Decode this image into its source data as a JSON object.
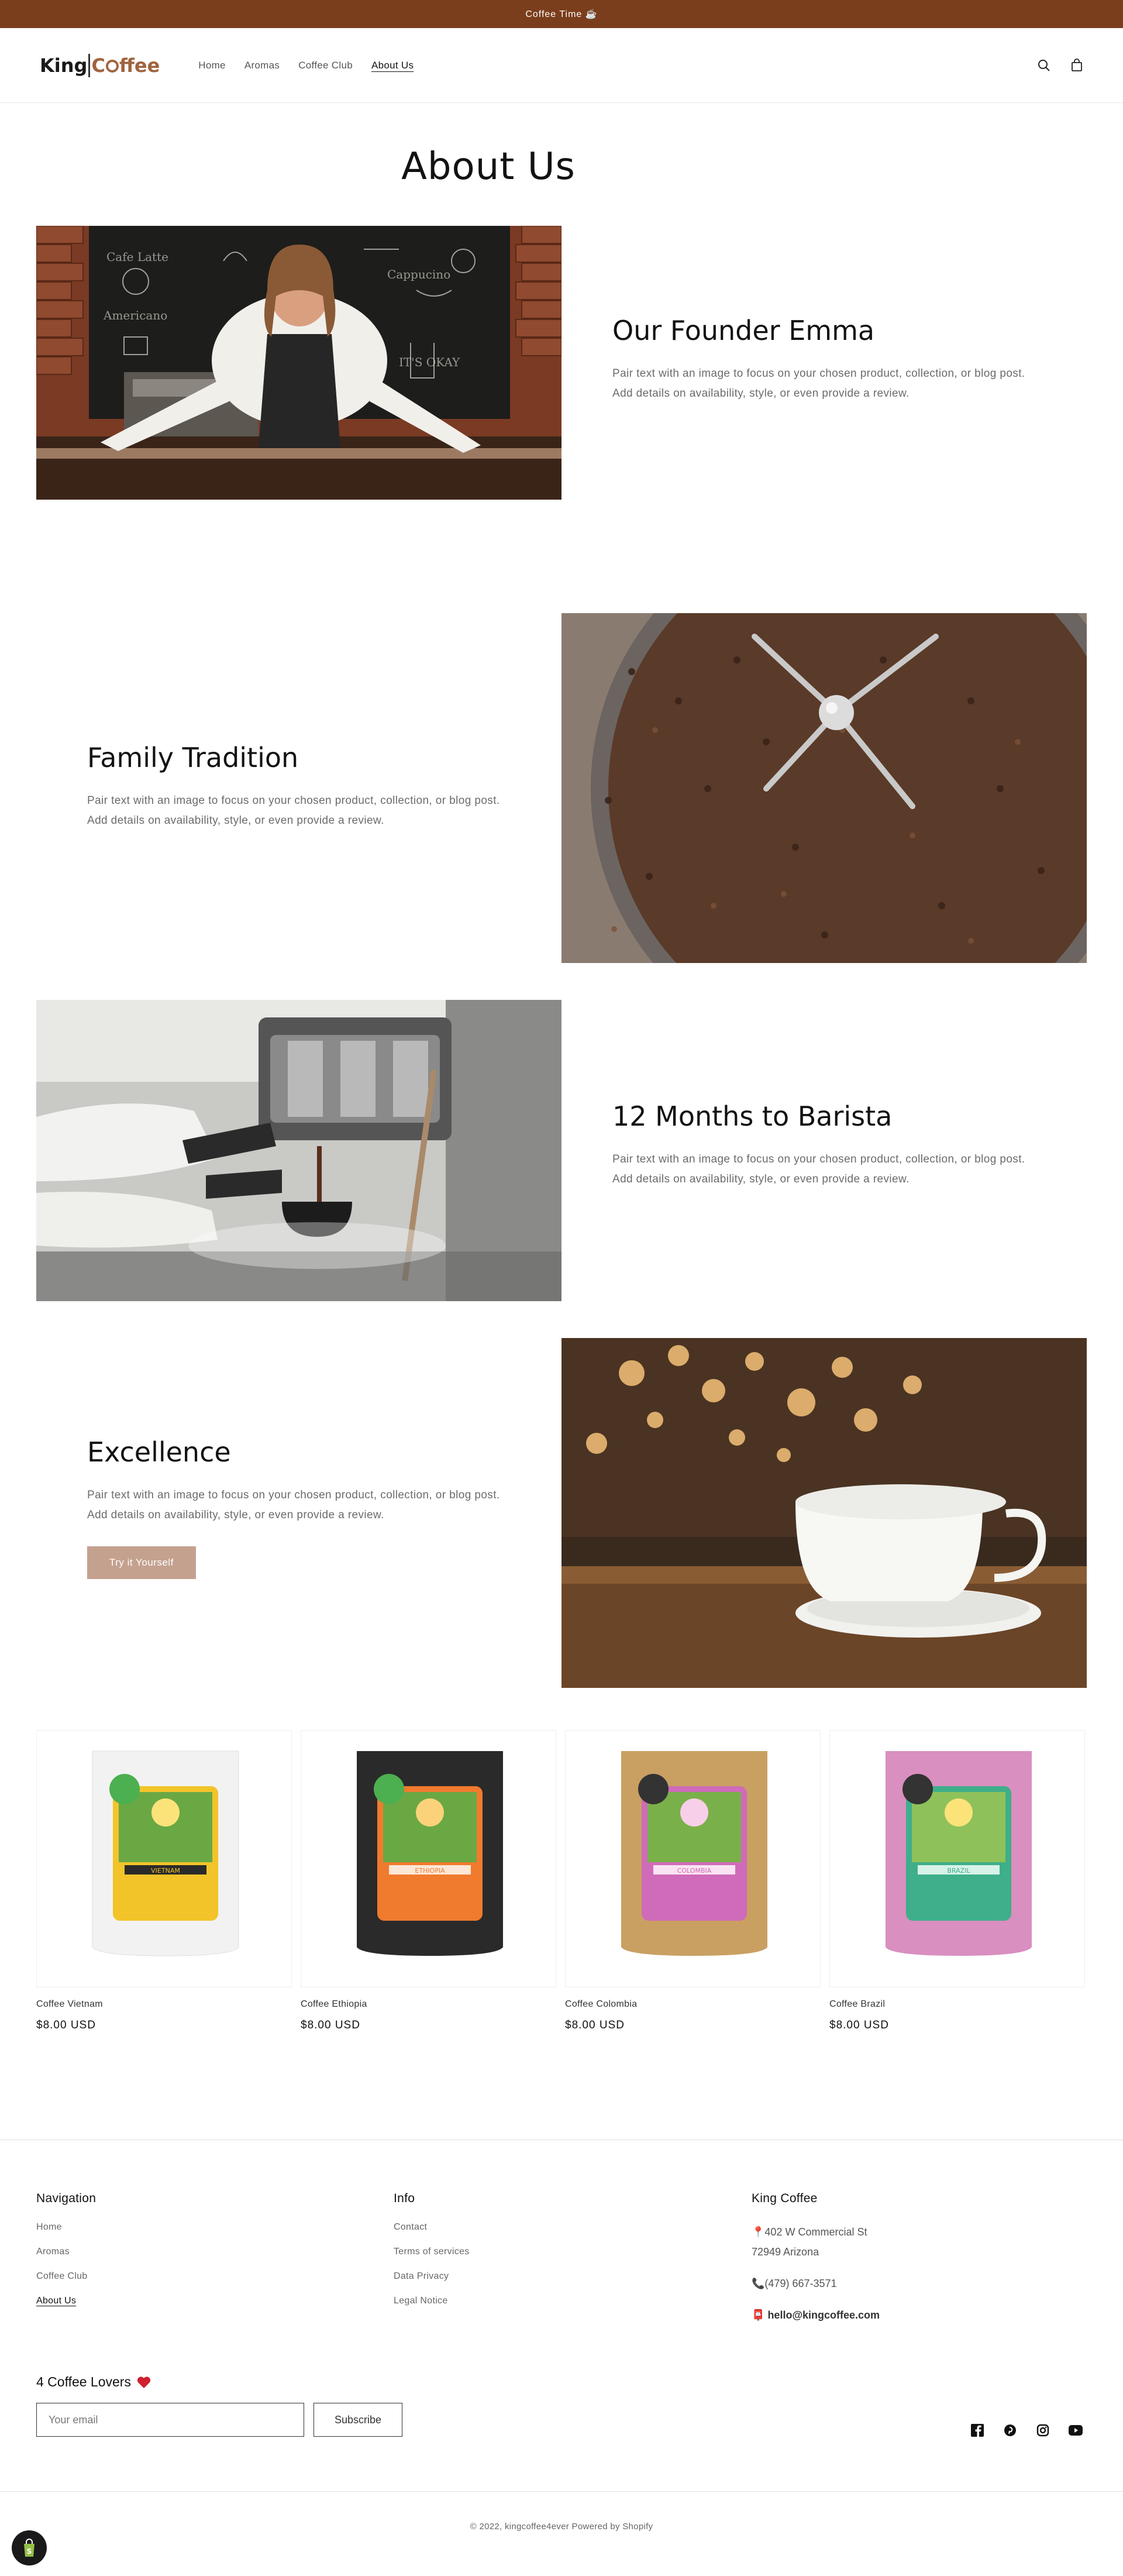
{
  "announcement": {
    "text": "Coffee Time ☕"
  },
  "header": {
    "logo_king": "King",
    "logo_c": "C",
    "logo_ffee": "ffee",
    "nav": [
      {
        "label": "Home"
      },
      {
        "label": "Aromas"
      },
      {
        "label": "Coffee Club"
      },
      {
        "label": "About Us"
      }
    ],
    "active_nav": "About Us",
    "icons": [
      "search-icon",
      "cart-icon"
    ]
  },
  "page": {
    "title": "About Us"
  },
  "sections": [
    {
      "heading": "Our Founder Emma",
      "body": "Pair text with an image to focus on your chosen product, collection, or blog post. Add details on availability, style, or even provide a review.",
      "image": "barista-woman-photo"
    },
    {
      "heading": "Family Tradition",
      "body": "Pair text with an image to focus on your chosen product, collection, or blog post. Add details on availability, style, or even provide a review.",
      "image": "coffee-roaster-photo"
    },
    {
      "heading": "12 Months to Barista",
      "body": "Pair text with an image to focus on your chosen product, collection, or blog post. Add details on availability, style, or even provide a review.",
      "image": "espresso-machine-photo"
    },
    {
      "heading": "Excellence",
      "body": "Pair text with an image to focus on your chosen product, collection, or blog post. Add details on availability, style, or even provide a review.",
      "button": "Try it Yourself",
      "image": "coffee-cup-photo"
    }
  ],
  "products": [
    {
      "name": "Coffee Vietnam",
      "price": "$8.00 USD",
      "label": "VIETNAM",
      "bag": "#f2f2f2",
      "accent": "#f2c42a"
    },
    {
      "name": "Coffee Ethiopia",
      "price": "$8.00 USD",
      "label": "ETHIOPIA",
      "bag": "#2a2a2a",
      "accent": "#f07a2e"
    },
    {
      "name": "Coffee Colombia",
      "price": "$8.00 USD",
      "label": "COLOMBIA",
      "bag": "#c9a062",
      "accent": "#cf6bb8"
    },
    {
      "name": "Coffee Brazil",
      "price": "$8.00 USD",
      "label": "BRAZIL",
      "bag": "#d98fbf",
      "accent": "#3fae8a"
    }
  ],
  "footer": {
    "navigation": {
      "heading": "Navigation",
      "links": [
        "Home",
        "Aromas",
        "Coffee Club",
        "About Us"
      ]
    },
    "info": {
      "heading": "Info",
      "links": [
        "Contact",
        "Terms of services",
        "Data Privacy",
        "Legal Notice"
      ]
    },
    "company": {
      "heading": "King Coffee",
      "address_line1": "402 W Commercial St",
      "address_line2": "72949 Arizona",
      "phone": "(479) 667-3571",
      "email": "hello@kingcoffee.com"
    },
    "newsletter": {
      "heading": "4 Coffee Lovers",
      "placeholder": "Your email",
      "button": "Subscribe"
    },
    "social": [
      "facebook-icon",
      "pinterest-icon",
      "instagram-icon",
      "youtube-icon"
    ],
    "copyright": "© 2022, kingcoffee4ever Powered by Shopify"
  },
  "colors": {
    "announcement_bg": "#7a3e1c",
    "brand_brown": "#a0643f",
    "button_bg": "#c4a18f"
  }
}
